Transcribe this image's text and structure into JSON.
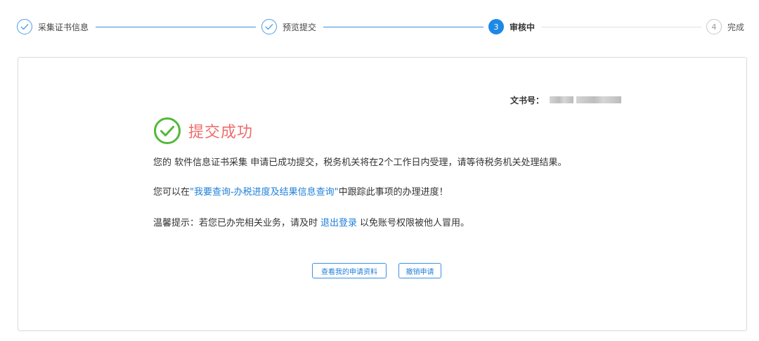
{
  "steps": [
    {
      "label": "采集证书信息",
      "state": "done"
    },
    {
      "label": "预览提交",
      "state": "done"
    },
    {
      "number": "3",
      "label": "审核中",
      "state": "active"
    },
    {
      "number": "4",
      "label": "完成",
      "state": "todo"
    }
  ],
  "document": {
    "label": "文书号："
  },
  "result": {
    "title": "提交成功",
    "line1": "您的 软件信息证书采集 申请已成功提交，税务机关将在2个工作日内受理，请等待税务机关处理结果。",
    "line2_prefix": "您可以在",
    "line2_link": "\"我要查询-办税进度及结果信息查询\"",
    "line2_suffix": "中跟踪此事项的办理进度！",
    "line3_prefix": "温馨提示：若您已办完相关业务，请及时",
    "line3_link": "退出登录",
    "line3_suffix": "以免账号权限被他人冒用。"
  },
  "buttons": {
    "view_application": "查看我的申请资料",
    "cancel_application": "撤销申请"
  },
  "colors": {
    "accent": "#1e88e5",
    "success_green": "#52b83a",
    "success_title": "#ef6c6c",
    "link": "#1f7fd8"
  }
}
